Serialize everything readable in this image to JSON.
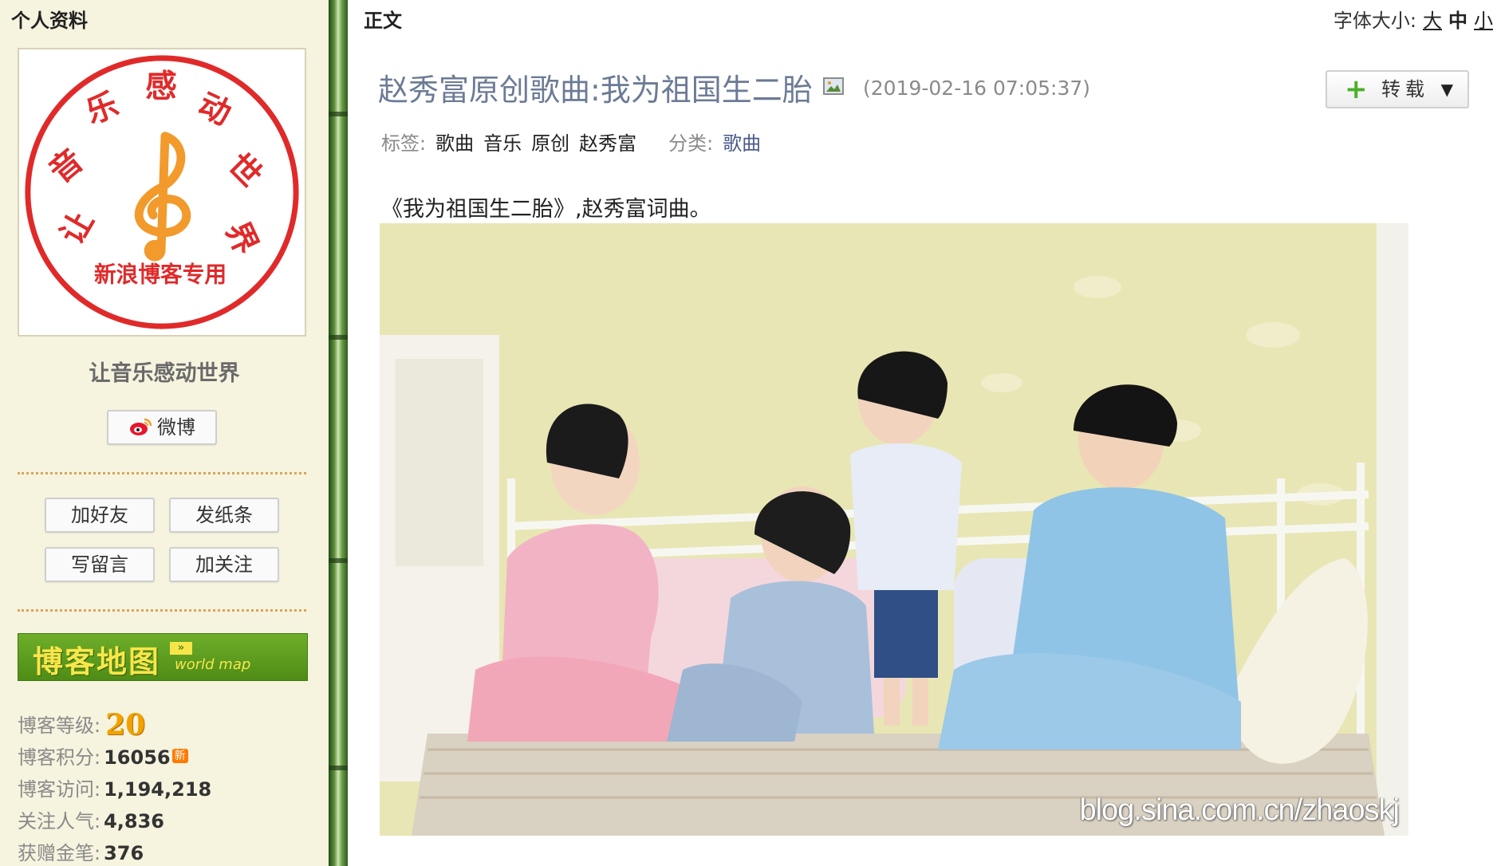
{
  "sidebar": {
    "section_title": "个人资料",
    "avatar": {
      "ring_text": "让音乐感动世界",
      "bottom_text": "新浪博客专用",
      "ring_color": "#e02a2a",
      "clef_color": "#f29a2b"
    },
    "blog_name": "让音乐感动世界",
    "weibo_button": "微博",
    "actions": {
      "add_friend": "加好友",
      "send_note": "发纸条",
      "leave_message": "写留言",
      "follow": "加关注"
    },
    "map_banner": {
      "title": "博客地图",
      "subtitle": "world map"
    },
    "stats": {
      "level_label": "博客等级:",
      "level_value": "20",
      "points_label": "博客积分:",
      "points_value": "16056",
      "points_badge": "新",
      "visits_label": "博客访问:",
      "visits_value": "1,194,218",
      "popularity_label": "关注人气:",
      "popularity_value": "4,836",
      "pens_label": "获赠金笔:",
      "pens_value": "376"
    }
  },
  "main": {
    "section_label": "正文",
    "font_size": {
      "label": "字体大小:",
      "large": "大",
      "medium": "中",
      "small": "小"
    },
    "post": {
      "title": "赵秀富原创歌曲:我为祖国生二胎",
      "time": "(2019-02-16 07:05:37)",
      "repost_label": "转载",
      "tags_label": "标签:",
      "tags": [
        "歌曲",
        "音乐",
        "原创",
        "赵秀富"
      ],
      "category_label": "分类:",
      "category": "歌曲",
      "intro": "《我为祖国生二胎》,赵秀富词曲。",
      "watermark": "blog.sina.com.cn/zhaoskj"
    }
  },
  "colors": {
    "sidebar_bg": "#f6f3df",
    "title_color": "#6c7b95",
    "link_color": "#4b5b8c",
    "map_green": "#5a9a1e"
  }
}
